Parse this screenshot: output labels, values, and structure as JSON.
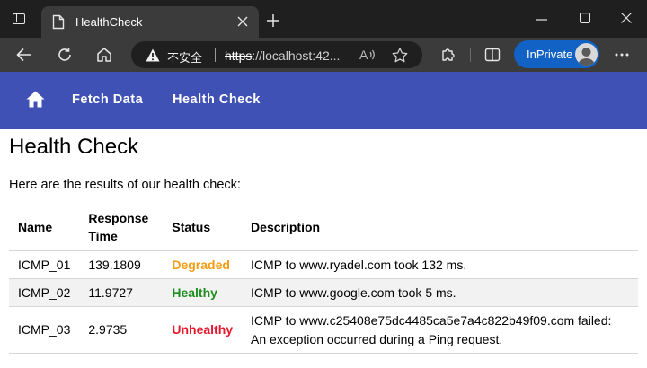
{
  "browser": {
    "tab_title": "HealthCheck",
    "insecure_label": "不安全",
    "url_scheme": "https",
    "url_rest": "://localhost:42...",
    "inprivate_label": "InPrivate"
  },
  "navbar": {
    "links": [
      {
        "label": "Fetch Data"
      },
      {
        "label": "Health Check"
      }
    ]
  },
  "page": {
    "title": "Health Check",
    "intro": "Here are the results of our health check:"
  },
  "table": {
    "headers": [
      "Name",
      "Response Time",
      "Status",
      "Description"
    ],
    "rows": [
      {
        "name": "ICMP_01",
        "response_time": "139.1809",
        "status": "Degraded",
        "status_color": "#f39c12",
        "description": "ICMP to www.ryadel.com took 132 ms."
      },
      {
        "name": "ICMP_02",
        "response_time": "11.9727",
        "status": "Healthy",
        "status_color": "#1e8e1e",
        "description": "ICMP to www.google.com took 5 ms."
      },
      {
        "name": "ICMP_03",
        "response_time": "2.9735",
        "status": "Unhealthy",
        "status_color": "#e8182c",
        "description": "ICMP to www.c25408e75dc4485ca5e7a4c822b49f09.com failed: An exception occurred during a Ping request."
      }
    ]
  },
  "colors": {
    "navbar": "#3f51b5",
    "inprivate": "#1261c4"
  }
}
